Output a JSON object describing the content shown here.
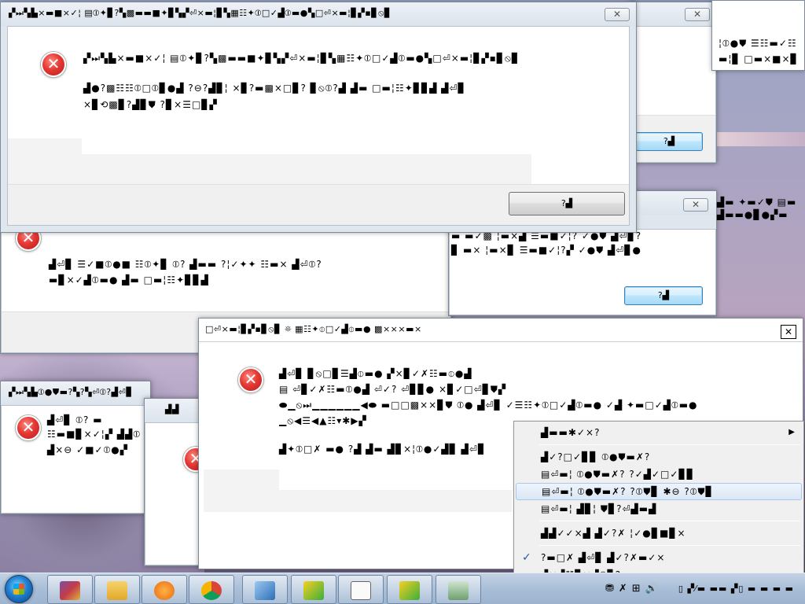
{
  "windows": {
    "top_dialog": {
      "title": "▞⏭▚▙×▬■×✓¦ ▤⦶✦▊?▚▩▬▬■✦▊▚▞⏎×▬¦▊▚▦☷✦⦶□✓▟⦶▬●▚□⏎×▬¦▊▞▪▊⦸▊",
      "heading": "▞⏭▚▙×▬■×✓¦ ▤⦶✦▊?▚▩▬▬■✦▊▚▞⏎×▬¦▊▚▦☷✦⦶□✓▟⦶▬●▚□⏎×▬¦▊▞▪▊⦸▊",
      "message": "▟●?▩☷☷⦶□⦶▊●▟ ?⊖?▟▊¦ ×▊?▬▩×□▊? ▊⦸⦶?▟ ▟▬ □▬¦☷✦▊▊▟ ▟⏎▊\n×▊⟲▩▊?▟▊⛊ ?▊×☰□▊▞",
      "ok_label": "?▟"
    },
    "right_top_dialog": {
      "message_line1": "¦⦶●⛊ ☰☷▬✓☷",
      "message_line2": "▬¦▊ □▬×■×▊",
      "ok_label": "?▟"
    },
    "mid_left_dialog": {
      "message_line1": "▟⏎▊ ☰✓■⦶●■ ☷⦶✦▊ ⦶? ▟▬▬ ?¦✓✦✦ ☷▬× ▟⏎⦶?",
      "message_line2": "▬▊×✓▟⦶▬● ▟▬ □▬¦☷✦▊▊▟"
    },
    "mid_right_dialog": {
      "title_right": "▟▬ ✦▬✓⛊ ▤▬",
      "title_right2": "▟▬▬●▊●▞▬",
      "message_line1": "▬ ▬✓▩ ¦▬×▟ ☰▬■✓¦? ✓●⛊ ▟⏎▊?",
      "message_line2": "▊ ▬× ¦▬×▊ ☰▬■✓¦?▞ ✓●⛊ ▟⏎▊●",
      "ok_label": "?▟"
    },
    "main_dialog": {
      "title": "□⏎×▬¦▊▞▪▊⦸▊ ⛯ ▦☷✦⦶□✓▟⦶▬● ▩×××▬×",
      "line1": "▟⏎▊ ▊⦸□▊☰▟⦶▬● ▞×▊✓✗☷▬⦶●▟",
      "line2": "▤ ⏎▊✓✗☷▬⦶●▟ ⏎✓? ⏎▊▊● ×▊✓□⏎▊⛊▞",
      "line3": "⬬▁⦸⏭▁▁▁▁▁▁◀⬬ ▬□□▩××▊⛊ ⦶● ▟⏎▊ ✓☰☷✦⦶□✓▟⦶▬● ✓▟ ✦▬□✓▟⦶▬●",
      "line4": "▁⦸◀☰◀▲☷▾✱▶▞",
      "line5": "▟✦⦶□✗ ▬● ?▟ ▟▬ ▟▊×¦⦶●✓▟▊ ▟⏎▊"
    },
    "bottom_left_dialog": {
      "title": "▞⏭▚▙⦶●⛊▬?▚?▚⏎⦶?▟⏎▊",
      "line1": "▟⏎▊ ⦶? ▬",
      "line2": "☷▬■▊×✓¦▞ ▟▟⦶",
      "line3": "▟×⊖ ✓■✓⦶●▞"
    },
    "bottom_small_dialog": {
      "title": "▟▟"
    }
  },
  "context_menu": {
    "items": [
      {
        "label": "▟▬▬✱✓×?",
        "has_submenu": true
      },
      {
        "label": "▟✓?□✓▊▊ ⦶●⛊▬✗?"
      },
      {
        "label": "▤⏎▬¦ ⦶●⛊▬✗? ?✓▟✓□✓▊▊"
      },
      {
        "label": "▤⏎▬¦ ⦶●⛊▬✗? ?⦶⛊▊ ✱⊖ ?⦶⛊▊"
      },
      {
        "label": "▤⏎▬¦ ▟▊¦ ⛊▊?⏎▟▬▟"
      },
      {
        "label": "▟▟✓✓×▟ ▟✓?✗ ¦✓●▊■▊×"
      },
      {
        "label": "?▬□✗ ▟⏎▊ ▟✓?✗▬✓×",
        "checked": true
      },
      {
        "label": "▟×▟☷▊×▟⦶▊?"
      }
    ]
  },
  "taskbar": {
    "apps": [
      "start-menu",
      "winrar",
      "explorer",
      "media-player",
      "chrome",
      "virtualbox",
      "norton-task",
      "notepad",
      "norton-task-2",
      "app-window"
    ],
    "clock_line1": "▯ ▞⁄▬ ▬▬",
    "clock_line2": "▞▯ ▬ ▬ ▬ ▬"
  }
}
